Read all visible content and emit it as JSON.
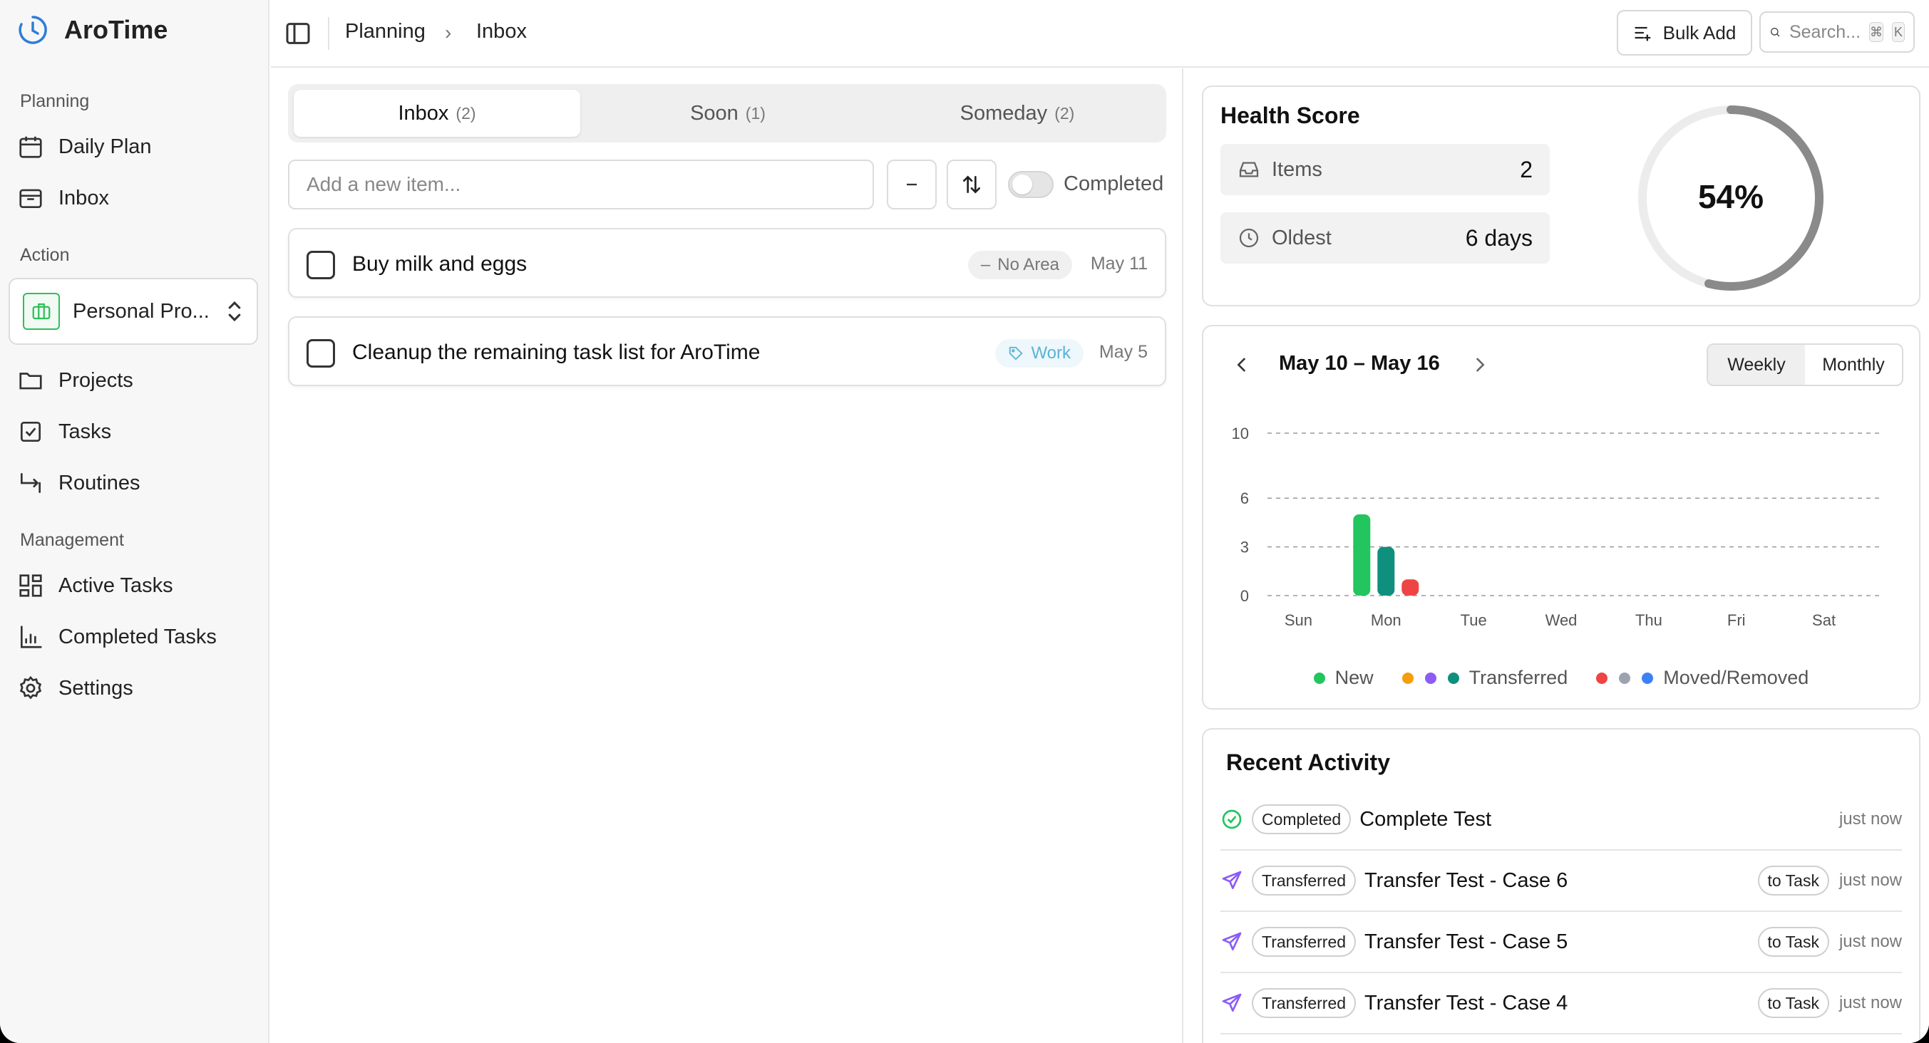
{
  "brand": {
    "name": "AroTime"
  },
  "sidebar": {
    "planning_label": "Planning",
    "action_label": "Action",
    "management_label": "Management",
    "planning_items": [
      {
        "label": "Daily Plan",
        "icon": "calendar-icon"
      },
      {
        "label": "Inbox",
        "icon": "inbox-icon"
      }
    ],
    "project_select": {
      "label": "Personal Pro..."
    },
    "action_items": [
      {
        "label": "Projects",
        "icon": "folder-icon"
      },
      {
        "label": "Tasks",
        "icon": "checkbox-icon"
      },
      {
        "label": "Routines",
        "icon": "repeat-icon"
      }
    ],
    "management_items": [
      {
        "label": "Active Tasks",
        "icon": "dashboard-icon"
      },
      {
        "label": "Completed Tasks",
        "icon": "chart-icon"
      },
      {
        "label": "Settings",
        "icon": "gear-icon"
      }
    ]
  },
  "header": {
    "breadcrumb": [
      "Planning",
      "Inbox"
    ],
    "bulk_add": "Bulk Add",
    "search_placeholder": "Search...",
    "kbd_cmd": "⌘",
    "kbd_k": "K"
  },
  "inbox": {
    "tabs": [
      {
        "label": "Inbox",
        "count": "(2)"
      },
      {
        "label": "Soon",
        "count": "(1)"
      },
      {
        "label": "Someday",
        "count": "(2)"
      }
    ],
    "add_placeholder": "Add a new item...",
    "completed_label": "Completed",
    "items": [
      {
        "title": "Buy milk and eggs",
        "tag": "No Area",
        "date": "May 11"
      },
      {
        "title": "Cleanup the remaining task list for AroTime",
        "tag": "Work",
        "date": "May 5"
      }
    ]
  },
  "health": {
    "title": "Health Score",
    "items_label": "Items",
    "items_value": "2",
    "oldest_label": "Oldest",
    "oldest_value": "6 days",
    "score_text": "54%",
    "score": 0.54
  },
  "week": {
    "range": "May 10 – May 16",
    "weekly": "Weekly",
    "monthly": "Monthly"
  },
  "chart_data": {
    "type": "bar",
    "categories": [
      "Sun",
      "Mon",
      "Tue",
      "Wed",
      "Thu",
      "Fri",
      "Sat"
    ],
    "series": [
      {
        "name": "New",
        "color": "#22c55e",
        "values": [
          0,
          5,
          0,
          0,
          0,
          0,
          0
        ]
      },
      {
        "name": "Transferred",
        "color": "#0f8f7e",
        "values": [
          0,
          3,
          0,
          0,
          0,
          0,
          0
        ]
      },
      {
        "name": "Moved/Removed",
        "color": "#ef4444",
        "values": [
          0,
          1,
          0,
          0,
          0,
          0,
          0
        ]
      }
    ],
    "yticks": [
      "10",
      "6",
      "3",
      "0"
    ],
    "ylim": [
      0,
      10
    ],
    "legend": [
      {
        "label": "New",
        "colors": [
          "#22c55e"
        ]
      },
      {
        "label": "Transferred",
        "colors": [
          "#f59e0b",
          "#8b5cf6",
          "#0f8f7e"
        ]
      },
      {
        "label": "Moved/Removed",
        "colors": [
          "#ef4444",
          "#9ca3af",
          "#3b82f6"
        ]
      }
    ],
    "legend_placement": "bottom",
    "grid": true
  },
  "activity": {
    "title": "Recent Activity",
    "rows": [
      {
        "badge": "Completed",
        "title": "Complete Test",
        "target": "",
        "time": "just now"
      },
      {
        "badge": "Transferred",
        "title": "Transfer Test - Case 6",
        "target": "to Task",
        "time": "just now"
      },
      {
        "badge": "Transferred",
        "title": "Transfer Test - Case 5",
        "target": "to Task",
        "time": "just now"
      },
      {
        "badge": "Transferred",
        "title": "Transfer Test - Case 4",
        "target": "to Task",
        "time": "just now"
      }
    ]
  },
  "colors": {
    "accent_blue": "#2f7dd6",
    "green": "#22c55e",
    "purple": "#8b5cf6",
    "ring": "#8a8a8a"
  }
}
